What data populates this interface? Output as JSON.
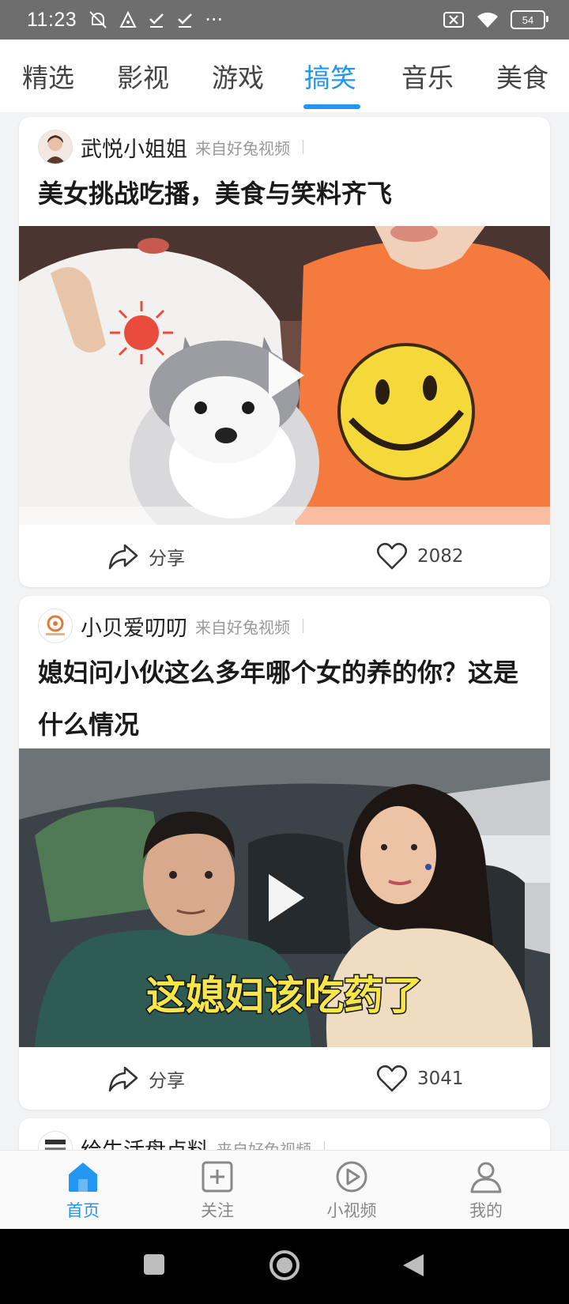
{
  "status_bar": {
    "time": "11:23",
    "dots": "···",
    "battery": "54",
    "icons": [
      "alarm-off-icon",
      "navigation-icon",
      "check-icon",
      "check-icon",
      "close-box-icon",
      "wifi-icon",
      "battery-icon"
    ]
  },
  "tabs": [
    {
      "label": "精选",
      "active": false
    },
    {
      "label": "影视",
      "active": false
    },
    {
      "label": "游戏",
      "active": false
    },
    {
      "label": "搞笑",
      "active": true
    },
    {
      "label": "音乐",
      "active": false
    },
    {
      "label": "美食",
      "active": false
    }
  ],
  "feed": [
    {
      "author": "武悦小姐姐",
      "source": "来自好兔视频",
      "title": "美女挑战吃播，美食与笑料齐飞",
      "share_label": "分享",
      "likes": "2082"
    },
    {
      "author": "小贝爱叨叨",
      "source": "来自好兔视频",
      "title": "媳妇问小伙这么多年哪个女的养的你？这是什么情况",
      "video_caption": "这媳妇该吃药了",
      "share_label": "分享",
      "likes": "3041"
    },
    {
      "author": "给生活盘点料",
      "source": "来自好兔视频"
    }
  ],
  "bottom_nav": [
    {
      "label": "首页",
      "icon": "home-icon",
      "active": true
    },
    {
      "label": "关注",
      "icon": "plus-box-icon",
      "active": false
    },
    {
      "label": "小视频",
      "icon": "play-circle-icon",
      "active": false
    },
    {
      "label": "我的",
      "icon": "person-icon",
      "active": false
    }
  ],
  "colors": {
    "accent": "#2196f3",
    "status_bar": "#6e6e6e",
    "background": "#f2f3f5"
  }
}
